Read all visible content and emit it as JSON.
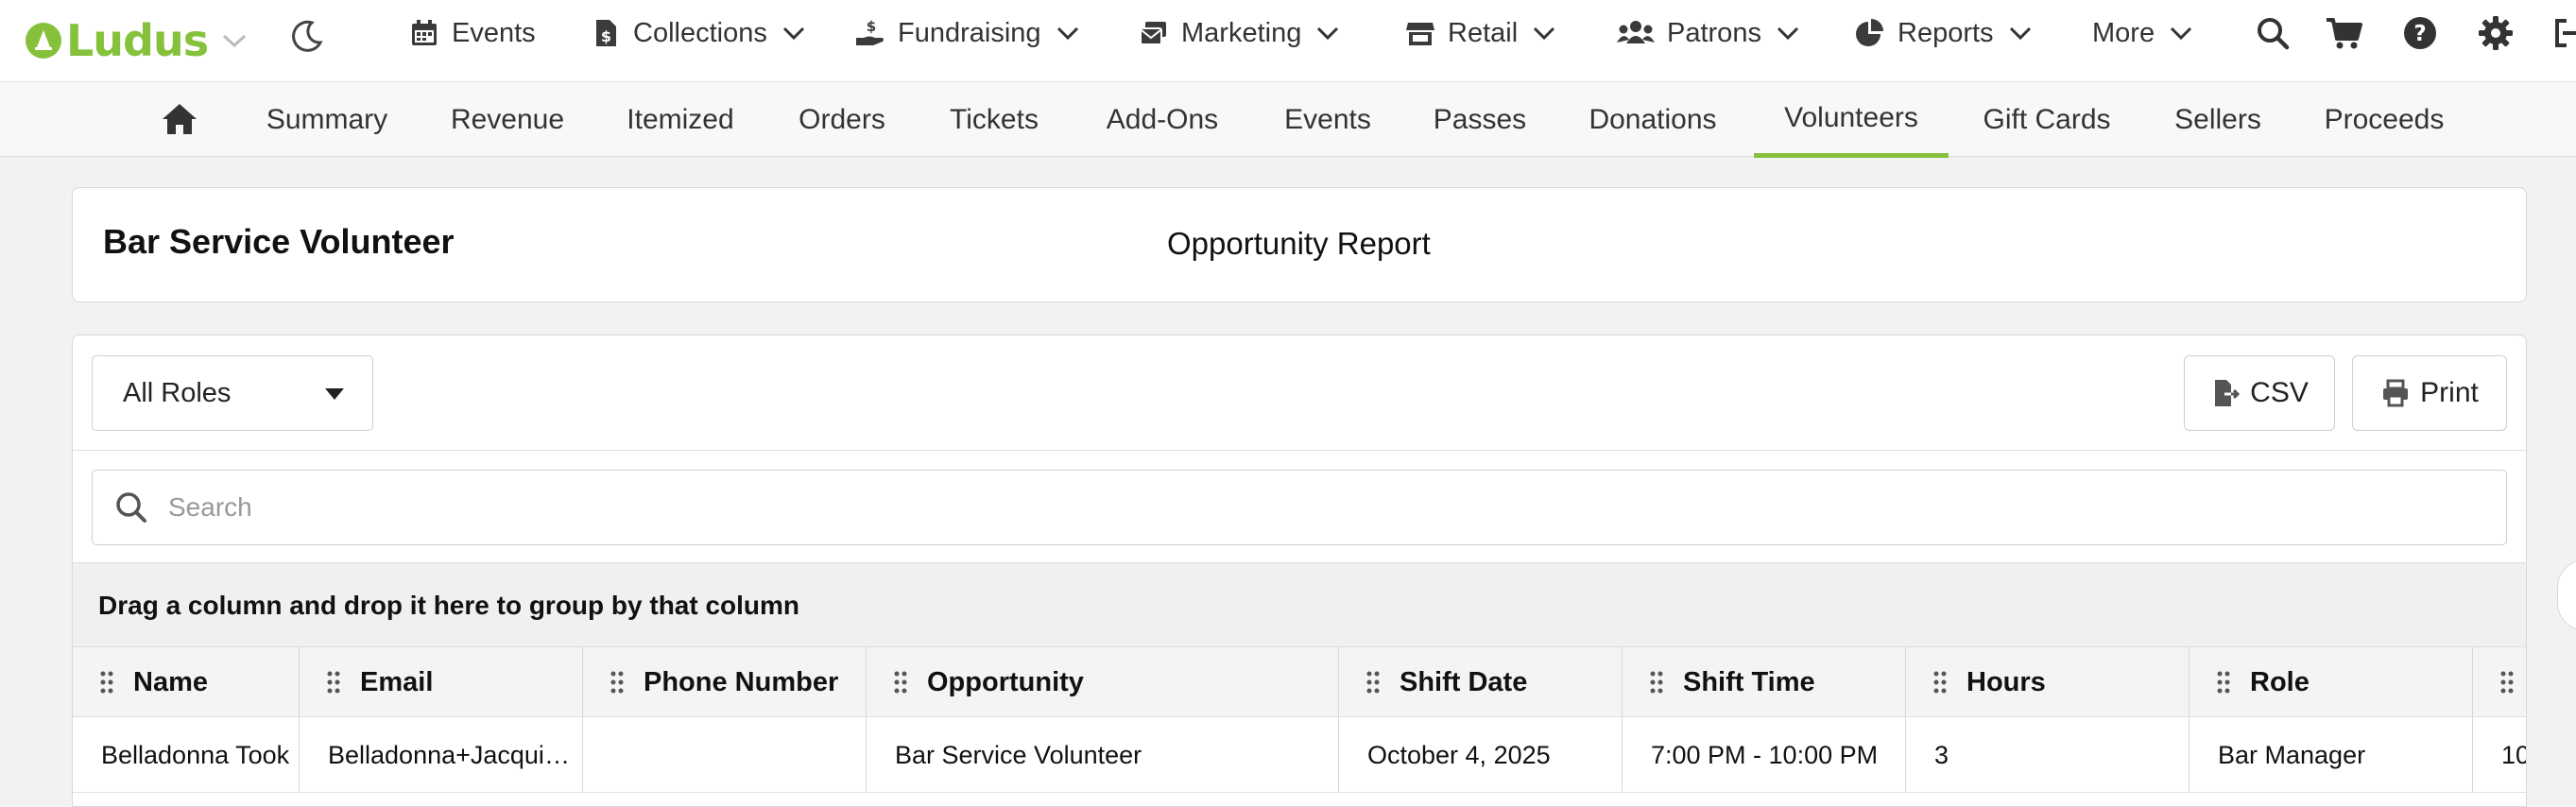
{
  "brand": {
    "name": "Ludus",
    "color": "#86c13c"
  },
  "topnav": [
    {
      "label": "Events",
      "icon": "calendar-icon",
      "dropdown": false
    },
    {
      "label": "Collections",
      "icon": "document-dollar-icon",
      "dropdown": true
    },
    {
      "label": "Fundraising",
      "icon": "hand-dollar-icon",
      "dropdown": true
    },
    {
      "label": "Marketing",
      "icon": "mail-stack-icon",
      "dropdown": true
    },
    {
      "label": "Retail",
      "icon": "store-icon",
      "dropdown": true
    },
    {
      "label": "Patrons",
      "icon": "people-icon",
      "dropdown": true
    },
    {
      "label": "Reports",
      "icon": "pie-chart-icon",
      "dropdown": true
    },
    {
      "label": "More",
      "icon": "",
      "dropdown": true
    }
  ],
  "utility_icons": [
    "search-icon",
    "cart-icon",
    "help-icon",
    "gear-icon",
    "logout-icon"
  ],
  "subnav": [
    {
      "label": "Summary"
    },
    {
      "label": "Revenue"
    },
    {
      "label": "Itemized"
    },
    {
      "label": "Orders"
    },
    {
      "label": "Tickets"
    },
    {
      "label": "Add-Ons"
    },
    {
      "label": "Events"
    },
    {
      "label": "Passes"
    },
    {
      "label": "Donations"
    },
    {
      "label": "Volunteers",
      "active": true
    },
    {
      "label": "Gift Cards"
    },
    {
      "label": "Sellers"
    },
    {
      "label": "Proceeds"
    }
  ],
  "title_card": {
    "name": "Bar Service Volunteer",
    "report": "Opportunity Report"
  },
  "toolbar": {
    "roles_value": "All Roles",
    "csv_label": "CSV",
    "print_label": "Print"
  },
  "search": {
    "placeholder": "Search"
  },
  "group_hint": "Drag a column and drop it here to group by that column",
  "table": {
    "columns": [
      "Name",
      "Email",
      "Phone Number",
      "Opportunity",
      "Shift Date",
      "Shift Time",
      "Hours",
      "Role",
      ""
    ],
    "rows": [
      [
        "Belladonna Took",
        "Belladonna+Jacquie…",
        "",
        "Bar Service Volunteer",
        "October 4, 2025",
        "7:00 PM - 10:00 PM",
        "3",
        "Bar Manager",
        "10"
      ]
    ]
  }
}
